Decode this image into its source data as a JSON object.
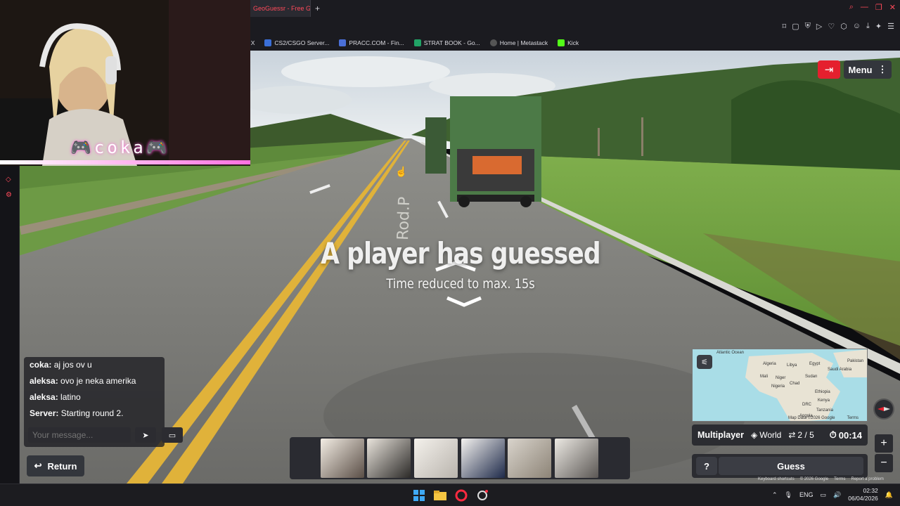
{
  "browser": {
    "active_tab": "GeoGuessr - Free Ge",
    "new_tab": "+",
    "bookmarks": [
      {
        "label": "/ X",
        "color": "#444"
      },
      {
        "label": "CS2/CSGO Server...",
        "color": "#3a6fd8"
      },
      {
        "label": "PRACC.COM - Fin...",
        "color": "#4a6fd8"
      },
      {
        "label": "STRAT BOOK - Go...",
        "color": "#21a366"
      },
      {
        "label": "Home | Metastack",
        "color": "#555"
      },
      {
        "label": "Kick",
        "color": "#53fc18"
      }
    ]
  },
  "webcam": {
    "overlay_name": "🎮coka🎮"
  },
  "game": {
    "exit_icon": "exit-icon",
    "menu_label": "Menu",
    "banner_title": "A player has guessed",
    "banner_sub": "Time reduced to max. 15s",
    "road_marking": "Rod.P",
    "chat": {
      "messages": [
        {
          "user": "coka:",
          "text": "aj jos ov u"
        },
        {
          "user": "aleksa:",
          "text": "ovo je neka amerika"
        },
        {
          "user": "aleksa:",
          "text": "latino"
        },
        {
          "user": "Server:",
          "text": "Starting round 2."
        }
      ],
      "input_placeholder": "Your message...",
      "send_icon": "send-icon",
      "log_icon": "chat-log-icon"
    },
    "return_label": "Return",
    "map": {
      "labels": [
        "Atlantic Ocean",
        "Algeria",
        "Libya",
        "Egypt",
        "Mali",
        "Niger",
        "Chad",
        "Sudan",
        "Nigeria",
        "Ethiopia",
        "Kenya",
        "DRC",
        "Tanzania",
        "Angola",
        "Saudi Arabia",
        "Pakistan"
      ],
      "attribution": "Map Data ©2026 Google",
      "terms": "Terms"
    },
    "info": {
      "mode": "Multiplayer",
      "map_name": "World",
      "round": "2 / 5",
      "timer": "00:14"
    },
    "help_label": "?",
    "guess_label": "Guess",
    "gmaps_footer": [
      "Keyboard shortcuts",
      "© 2026 Google",
      "Terms",
      "Report a problem"
    ]
  },
  "taskbar": {
    "language": "ENG",
    "time": "02:32",
    "date": "06/04/2026"
  }
}
